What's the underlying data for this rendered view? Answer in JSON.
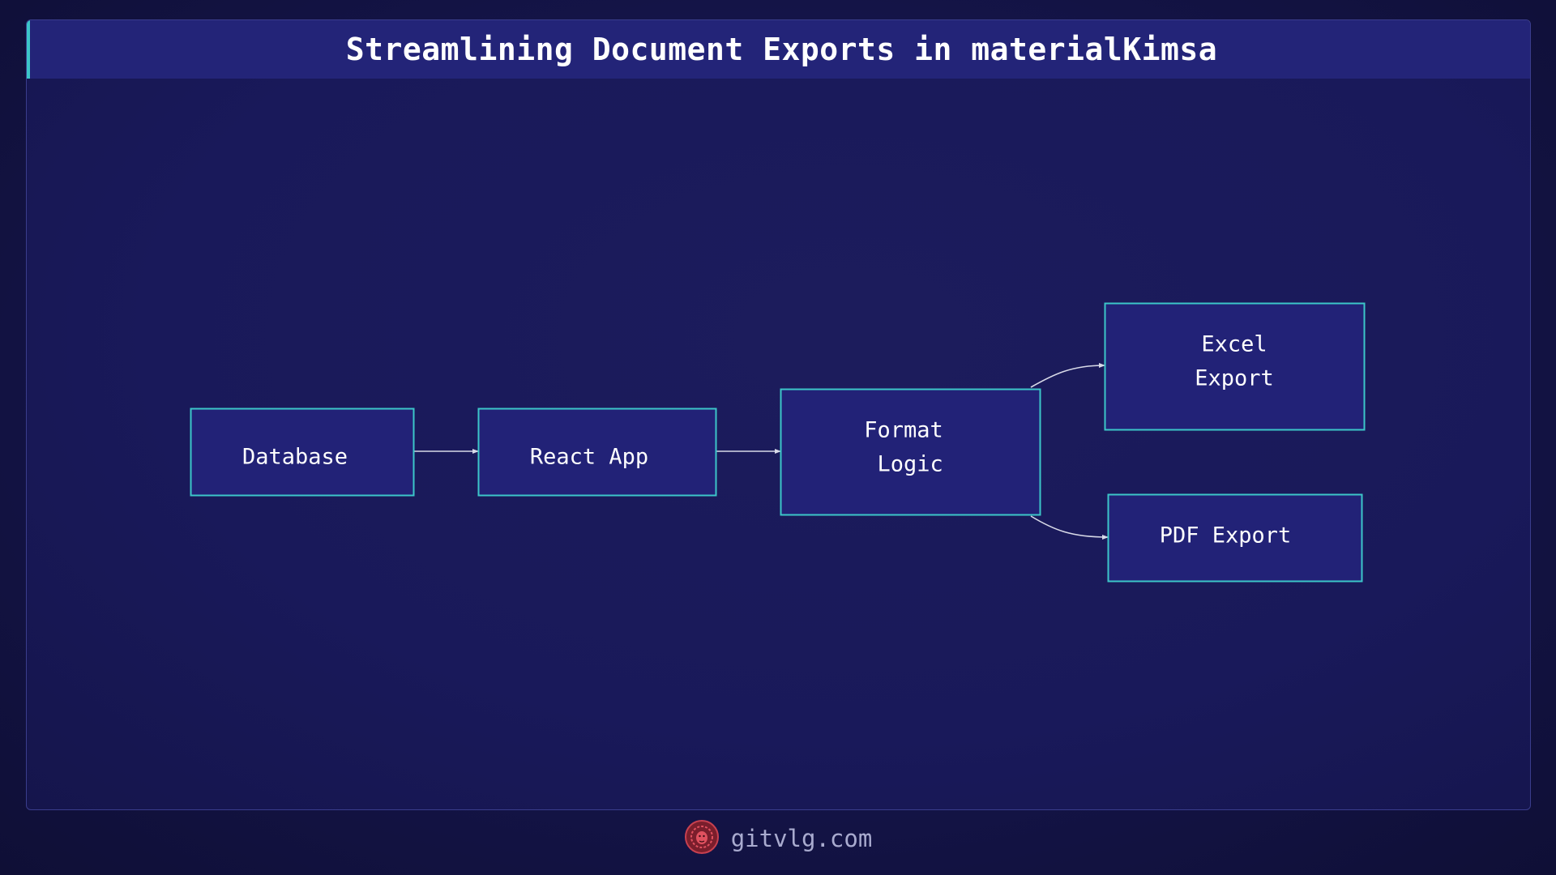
{
  "title": "Streamlining Document Exports in materialKimsa",
  "nodes": {
    "database": {
      "lines": [
        "Database"
      ]
    },
    "react_app": {
      "lines": [
        "React App"
      ]
    },
    "format_logic": {
      "lines": [
        "Format",
        " Logic"
      ]
    },
    "excel_export": {
      "lines": [
        "Excel",
        "Export"
      ]
    },
    "pdf_export": {
      "lines": [
        "PDF Export"
      ]
    }
  },
  "edges": [
    {
      "from": "database",
      "to": "react_app"
    },
    {
      "from": "react_app",
      "to": "format_logic"
    },
    {
      "from": "format_logic",
      "to": "excel_export"
    },
    {
      "from": "format_logic",
      "to": "pdf_export"
    }
  ],
  "colors": {
    "node_fill": "#222277",
    "node_border": "#3cc6c9",
    "edge": "#d8dae8",
    "accent": "#3cc6c9"
  },
  "footer": {
    "text": "gitvlg.com",
    "logo": "lion-logo-icon"
  }
}
